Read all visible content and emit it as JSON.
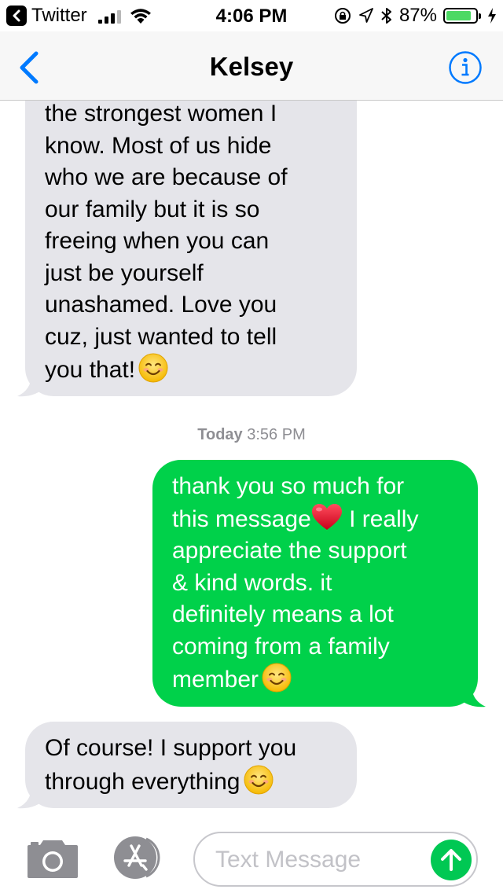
{
  "status_bar": {
    "back_app": "Twitter",
    "time": "4:06 PM",
    "battery": "87%",
    "battery_level": 0.87,
    "signal_bars": 3
  },
  "nav": {
    "title": "Kelsey",
    "back_icon": "chevron-left-icon",
    "info_icon": "info-icon"
  },
  "conversation": {
    "messages": [
      {
        "direction": "incoming",
        "text": "the strongest women I\nknow. Most of us hide\nwho we are because of\nour family but it is so\nfreeing when you can\njust be yourself\nunashamed. Love you\ncuz,  just wanted to tell\nyou that!",
        "emoji": "smiling-face"
      },
      {
        "direction": "outgoing",
        "text_before_heart": "thank you so much for\nthis message",
        "text_after_heart": " I really\nappreciate the support\n& kind words. it\ndefinitely means a lot\ncoming from a family\nmember",
        "emoji": "smiling-face"
      },
      {
        "direction": "incoming",
        "text": "Of course! I support you\nthrough everything",
        "emoji": "smiling-face"
      }
    ],
    "timestamp_day": "Today",
    "timestamp_time": "3:56 PM"
  },
  "input_bar": {
    "placeholder": "Text Message",
    "value": ""
  },
  "colors": {
    "incoming_bubble": "#e5e5ea",
    "outgoing_bubble": "#00d14a",
    "ios_blue": "#007aff",
    "send_green": "#00c853"
  }
}
